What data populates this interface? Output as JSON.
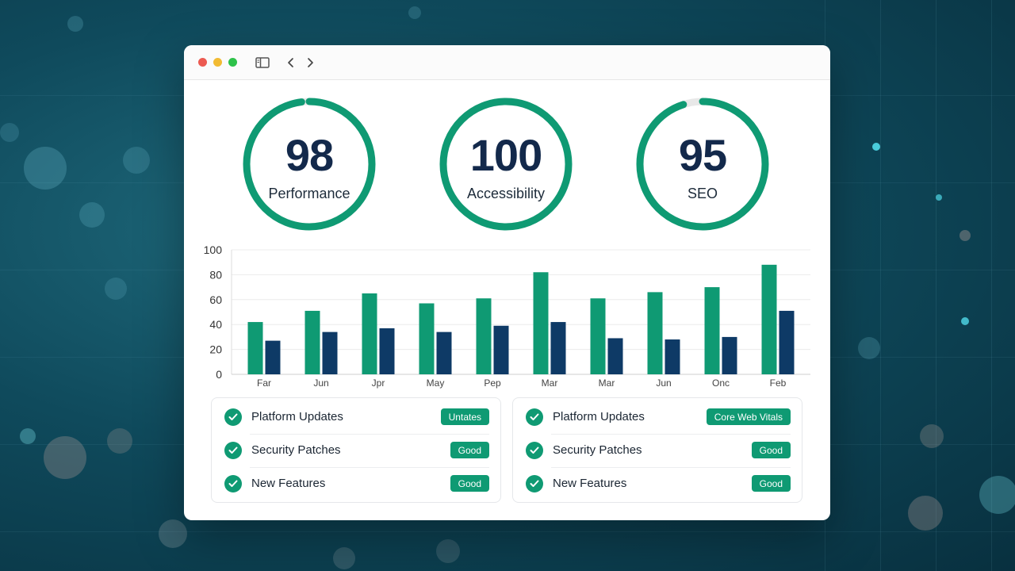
{
  "colors": {
    "accent_green": "#0f9a73",
    "navy": "#0e3a66",
    "gauge_track": "#e8e8e8"
  },
  "window": {
    "traffic_lights": [
      "#ec5a51",
      "#f2bb33",
      "#2ec24a"
    ],
    "icons": [
      "sidebar-icon",
      "back-icon",
      "forward-icon"
    ]
  },
  "scores": [
    {
      "value": "98",
      "label": "Performance",
      "score": 98
    },
    {
      "value": "100",
      "label": "Accessibility",
      "score": 100
    },
    {
      "value": "95",
      "label": "SEO",
      "score": 95
    }
  ],
  "chart_data": {
    "type": "bar",
    "categories": [
      "Far",
      "Jun",
      "Jpr",
      "May",
      "Pep",
      "Mar",
      "Mar",
      "Jun",
      "Onc",
      "Feb"
    ],
    "series": [
      {
        "values": [
          42,
          51,
          65,
          57,
          61,
          82,
          61,
          66,
          70,
          88
        ],
        "color": "#0f9a73"
      },
      {
        "values": [
          27,
          34,
          37,
          34,
          39,
          42,
          29,
          28,
          30,
          51
        ],
        "color": "#0e3a66"
      }
    ],
    "y_ticks": [
      "100",
      "80",
      "60",
      "40",
      "20",
      "0"
    ],
    "ylim": [
      0,
      100
    ],
    "grid": true,
    "legend": "none"
  },
  "checklists": [
    {
      "items": [
        {
          "label": "Platform Updates",
          "badge": "Untates"
        },
        {
          "label": "Security Patches",
          "badge": "Good"
        },
        {
          "label": "New Features",
          "badge": "Good"
        }
      ]
    },
    {
      "items": [
        {
          "label": "Platform Updates",
          "badge": "Core Web Vitals"
        },
        {
          "label": "Security Patches",
          "badge": "Good"
        },
        {
          "label": "New Features",
          "badge": "Good"
        }
      ]
    }
  ]
}
